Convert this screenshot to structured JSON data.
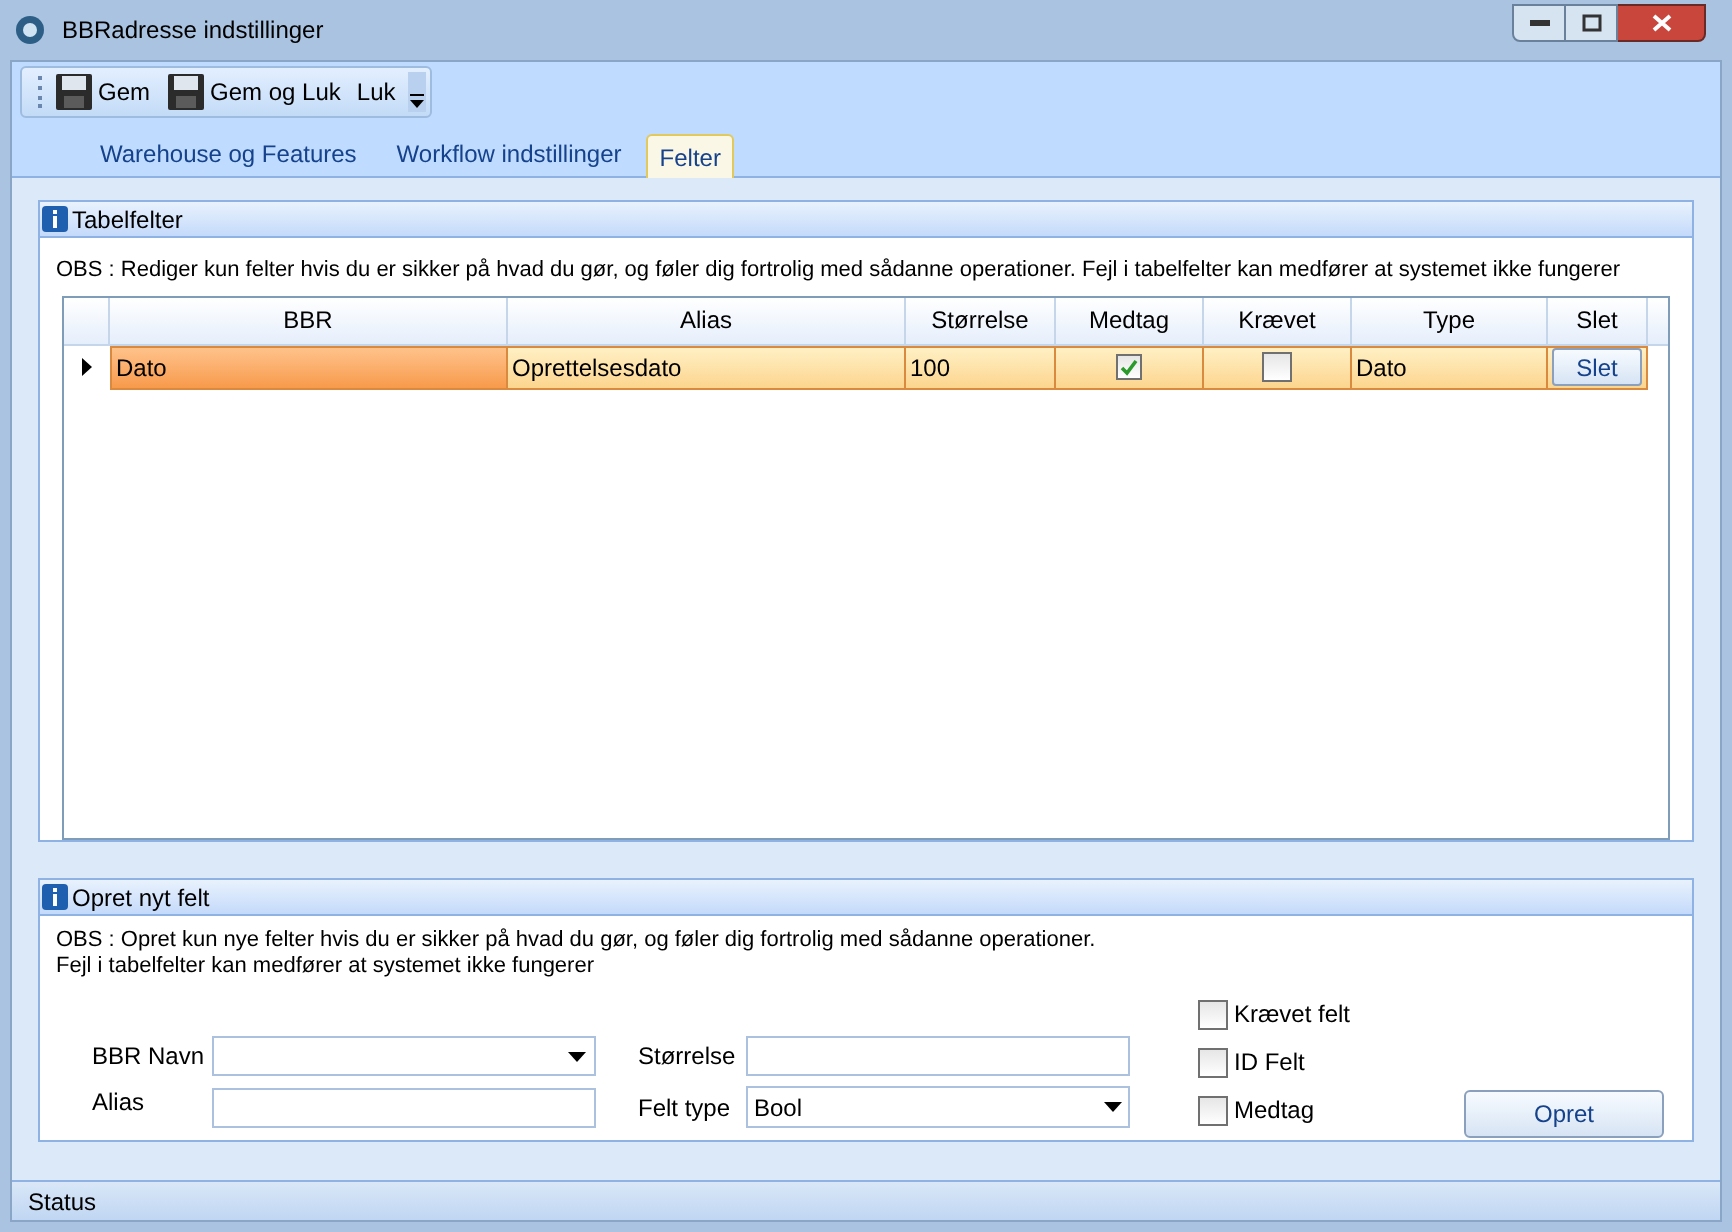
{
  "window": {
    "title": "BBRadresse indstillinger"
  },
  "toolbar": [
    {
      "label": "Gem",
      "kind": "save"
    },
    {
      "label": "Gem og Luk",
      "kind": "save"
    },
    {
      "label": "Luk",
      "kind": "text"
    }
  ],
  "tabs": [
    {
      "label": "Warehouse og Features",
      "selected": false
    },
    {
      "label": "Workflow indstillinger",
      "selected": false
    },
    {
      "label": "Felter",
      "selected": true
    }
  ],
  "table_panel": {
    "title": "Tabelfelter",
    "note": "OBS : Rediger kun  felter hvis du er sikker på hvad du gør, og føler dig fortrolig med sådanne operationer. Fejl i tabelfelter kan medfører at systemet ikke fungerer",
    "columns": [
      "BBR",
      "Alias",
      "Størrelse",
      "Medtag",
      "Krævet",
      "Type",
      "Slet"
    ],
    "rows": [
      {
        "selected": true,
        "bbr": "Dato",
        "alias": "Oprettelsesdato",
        "size": "100",
        "medtag": true,
        "kraevet": false,
        "type": "Dato",
        "delete": "Slet"
      }
    ]
  },
  "create_panel": {
    "title": "Opret nyt felt",
    "note_lines": [
      "OBS : Opret kun nye felter hvis du er sikker på hvad du gør, og føler dig fortrolig med sådanne operationer.",
      "Fejl i tabelfelter kan medfører at systemet ikke fungerer"
    ],
    "bbr_name_label": "BBR Navn",
    "alias_label": "Alias",
    "size_label": "Størrelse",
    "field_type_label": "Felt type",
    "field_type_value": "Bool",
    "checkboxes": [
      {
        "label": "Krævet felt",
        "checked": false
      },
      {
        "label": "ID Felt",
        "checked": false
      },
      {
        "label": "Medtag",
        "checked": false
      }
    ],
    "create_button": "Opret"
  },
  "status_bar": "Status"
}
